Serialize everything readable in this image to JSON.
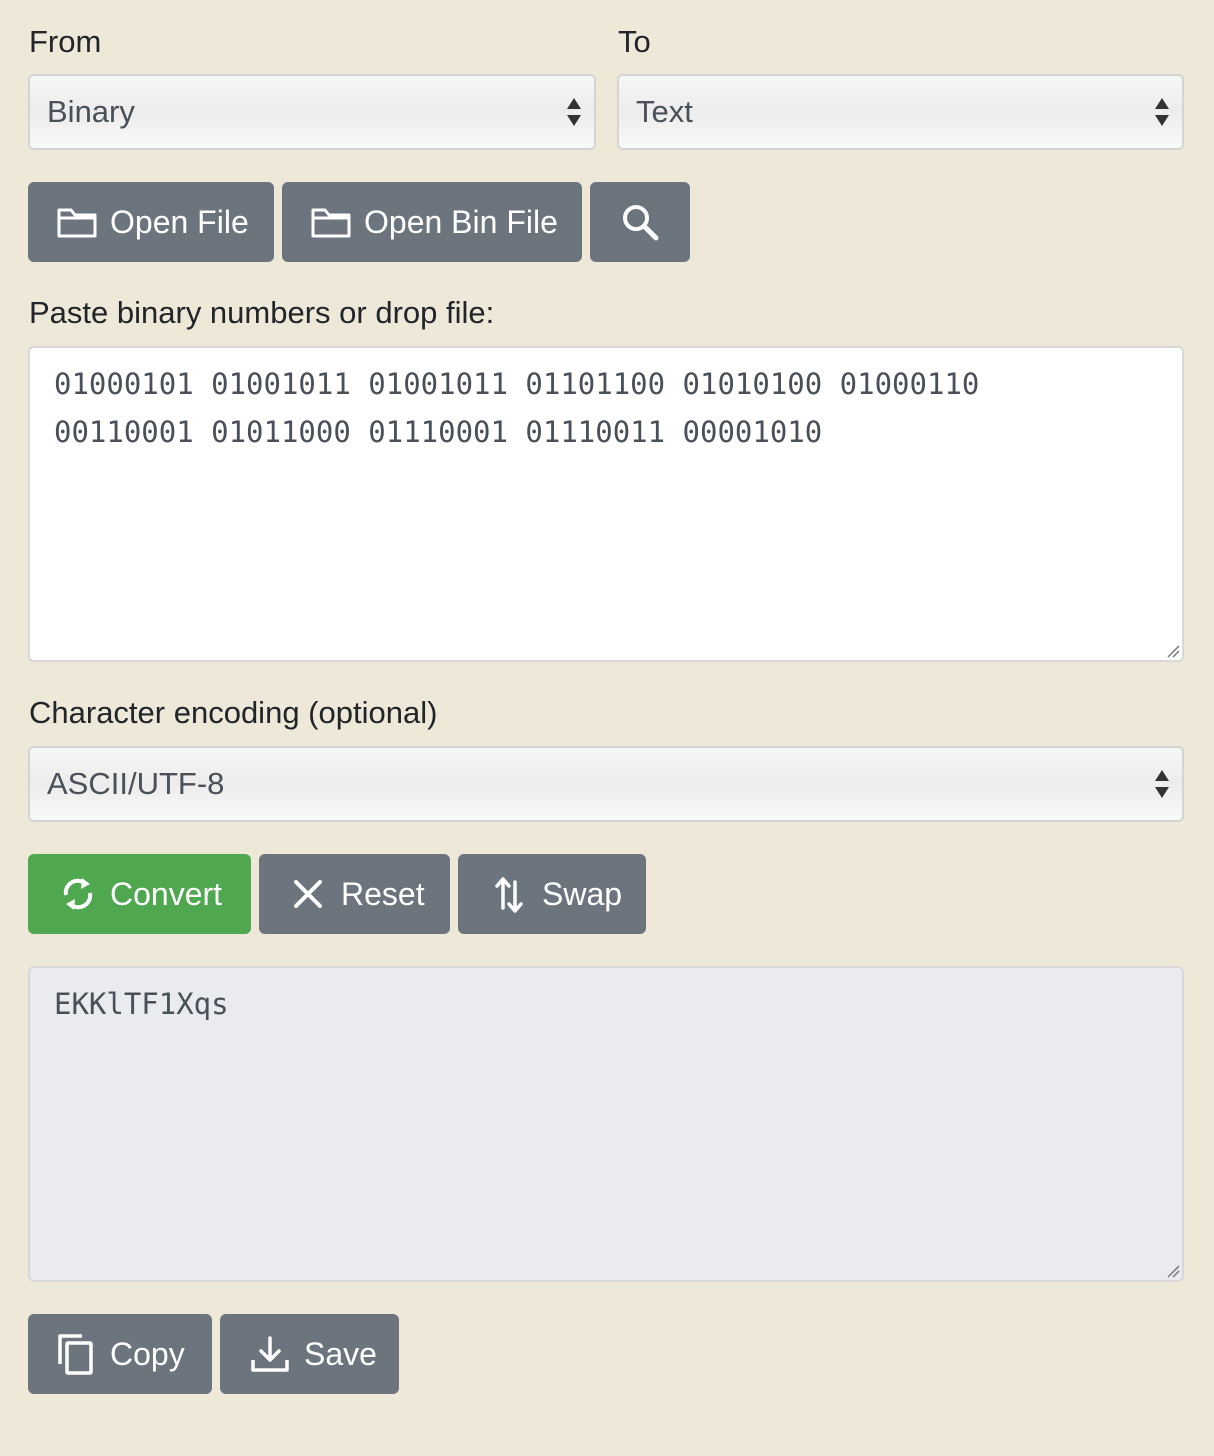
{
  "from": {
    "label": "From",
    "selected": "Binary"
  },
  "to": {
    "label": "To",
    "selected": "Text"
  },
  "file_buttons": {
    "open_file": "Open File",
    "open_bin_file": "Open Bin File",
    "search_icon": "search-icon"
  },
  "input": {
    "label": "Paste binary numbers or drop file:",
    "value": "01000101 01001011 01001011 01101100 01010100 01000110\n00110001 01011000 01110001 01110011 00001010"
  },
  "encoding": {
    "label": "Character encoding (optional)",
    "selected": "ASCII/UTF-8"
  },
  "actions": {
    "convert": "Convert",
    "reset": "Reset",
    "swap": "Swap"
  },
  "output": {
    "value": "EKKlTF1Xqs"
  },
  "output_actions": {
    "copy": "Copy",
    "save": "Save"
  },
  "colors": {
    "background": "#ede8d8",
    "button_gray": "#6c757d",
    "button_green": "#4fa84f",
    "output_bg": "#e9ebef"
  }
}
